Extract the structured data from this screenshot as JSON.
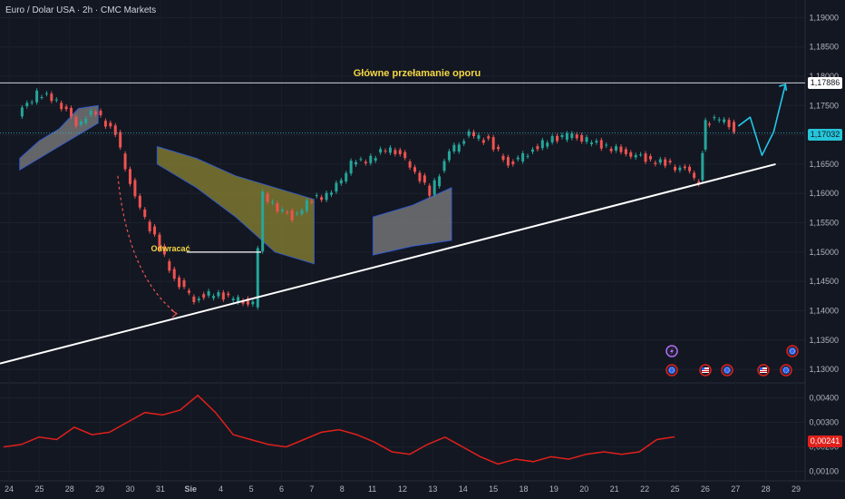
{
  "header": {
    "title": "Euro / Dolar USA · 2h · CMC Markets"
  },
  "annotations": {
    "resistance_break": "Główne przełamanie oporu",
    "reversal": "Odwracać"
  },
  "price_tags": {
    "resistance": "1,17886",
    "current": "1,17032",
    "indicator": "0,00241"
  },
  "colors": {
    "background": "#131722",
    "bull": "#26a69a",
    "bear": "#ef5350",
    "cloud_bear": "#808080",
    "cloud_bull": "#8c8432",
    "indicator": "#e0201b",
    "projection": "#22c7e8",
    "trendline": "#ffffff",
    "annotation_text": "#f5d742",
    "current_price_tag": "#26c6da",
    "indicator_tag": "#e0201b"
  },
  "icons": [
    "lightning-event-icon",
    "eu-flag-icon",
    "us-flag-icon",
    "eu-flag-icon",
    "us-flag-icon",
    "eu-flag-icon",
    "eu-flag-icon"
  ],
  "chart_data": [
    {
      "type": "candlestick",
      "title": "",
      "y_ticks": [
        "1,19000",
        "1,18500",
        "1,18000",
        "1,17500",
        "1,17000",
        "1,16500",
        "1,16000",
        "1,15500",
        "1,15000",
        "1,14500",
        "1,14000",
        "1,13500",
        "1,13000"
      ],
      "ylim": [
        1.128,
        1.193
      ],
      "x_ticks": [
        "24",
        "25",
        "28",
        "29",
        "30",
        "31",
        "Sie",
        "4",
        "5",
        "6",
        "7",
        "8",
        "11",
        "12",
        "13",
        "14",
        "15",
        "18",
        "19",
        "20",
        "21",
        "22",
        "25",
        "26",
        "27",
        "28",
        "29"
      ],
      "price_points": [
        [
          0,
          1.1735
        ],
        [
          1,
          1.177
        ],
        [
          2,
          1.176
        ],
        [
          3,
          1.172
        ],
        [
          4,
          1.174
        ],
        [
          5,
          1.17
        ],
        [
          6,
          1.159
        ],
        [
          7,
          1.1525
        ],
        [
          8,
          1.1455
        ],
        [
          9,
          1.142
        ],
        [
          10,
          1.143
        ],
        [
          11,
          1.142
        ],
        [
          12,
          1.141
        ],
        [
          12.5,
          1.16
        ],
        [
          13,
          1.158
        ],
        [
          14,
          1.156
        ],
        [
          15,
          1.159
        ],
        [
          16,
          1.16
        ],
        [
          17,
          1.165
        ],
        [
          18,
          1.166
        ],
        [
          19,
          1.168
        ],
        [
          20,
          1.165
        ],
        [
          21,
          1.16
        ],
        [
          22,
          1.167
        ],
        [
          23,
          1.17
        ],
        [
          24,
          1.169
        ],
        [
          25,
          1.165
        ],
        [
          26,
          1.167
        ],
        [
          27,
          1.169
        ],
        [
          28,
          1.17
        ],
        [
          29,
          1.169
        ],
        [
          30,
          1.168
        ],
        [
          31,
          1.167
        ],
        [
          32,
          1.166
        ],
        [
          33,
          1.165
        ],
        [
          34,
          1.164
        ],
        [
          34.7,
          1.162
        ],
        [
          35,
          1.172
        ],
        [
          36,
          1.173
        ],
        [
          36.5,
          1.1705
        ]
      ],
      "resistance_level": 1.17886,
      "current_price": 1.17032,
      "trendline": [
        [
          -1,
          1.131
        ],
        [
          38.5,
          1.165
        ]
      ],
      "projection": [
        [
          36.6,
          1.1715
        ],
        [
          37.2,
          1.173
        ],
        [
          37.8,
          1.1665
        ],
        [
          38.4,
          1.1705
        ],
        [
          39.0,
          1.1786
        ]
      ],
      "cloud_bear_regions": [
        [
          [
            0,
            1.166
          ],
          [
            1,
            1.169
          ],
          [
            2,
            1.171
          ],
          [
            3,
            1.1745
          ],
          [
            4,
            1.175
          ],
          [
            4,
            1.172
          ],
          [
            3,
            1.17
          ],
          [
            2,
            1.168
          ],
          [
            1,
            1.166
          ],
          [
            0,
            1.164
          ]
        ],
        [
          [
            18,
            1.156
          ],
          [
            20,
            1.158
          ],
          [
            22,
            1.161
          ],
          [
            22,
            1.152
          ],
          [
            20,
            1.151
          ],
          [
            18,
            1.1495
          ]
        ]
      ],
      "cloud_bull_regions": [
        [
          [
            7,
            1.168
          ],
          [
            9,
            1.166
          ],
          [
            11,
            1.163
          ],
          [
            13,
            1.161
          ],
          [
            15,
            1.159
          ],
          [
            15,
            1.148
          ],
          [
            13,
            1.15
          ],
          [
            11,
            1.156
          ],
          [
            9,
            1.161
          ],
          [
            7,
            1.165
          ]
        ]
      ]
    },
    {
      "type": "line",
      "title": "",
      "y_ticks": [
        "0,00400",
        "0,00300",
        "0,00200",
        "0,00100"
      ],
      "ylim": [
        0.0008,
        0.0045
      ],
      "current_value": 0.00241,
      "values": [
        0.002,
        0.0021,
        0.0024,
        0.0023,
        0.0028,
        0.0025,
        0.0026,
        0.003,
        0.0034,
        0.0033,
        0.0035,
        0.0041,
        0.0034,
        0.0025,
        0.0023,
        0.0021,
        0.002,
        0.0023,
        0.0026,
        0.0027,
        0.0025,
        0.0022,
        0.0018,
        0.0017,
        0.0021,
        0.0024,
        0.002,
        0.0016,
        0.0013,
        0.0015,
        0.0014,
        0.0016,
        0.0015,
        0.0017,
        0.0018,
        0.0017,
        0.0018,
        0.0023,
        0.00241
      ]
    }
  ]
}
